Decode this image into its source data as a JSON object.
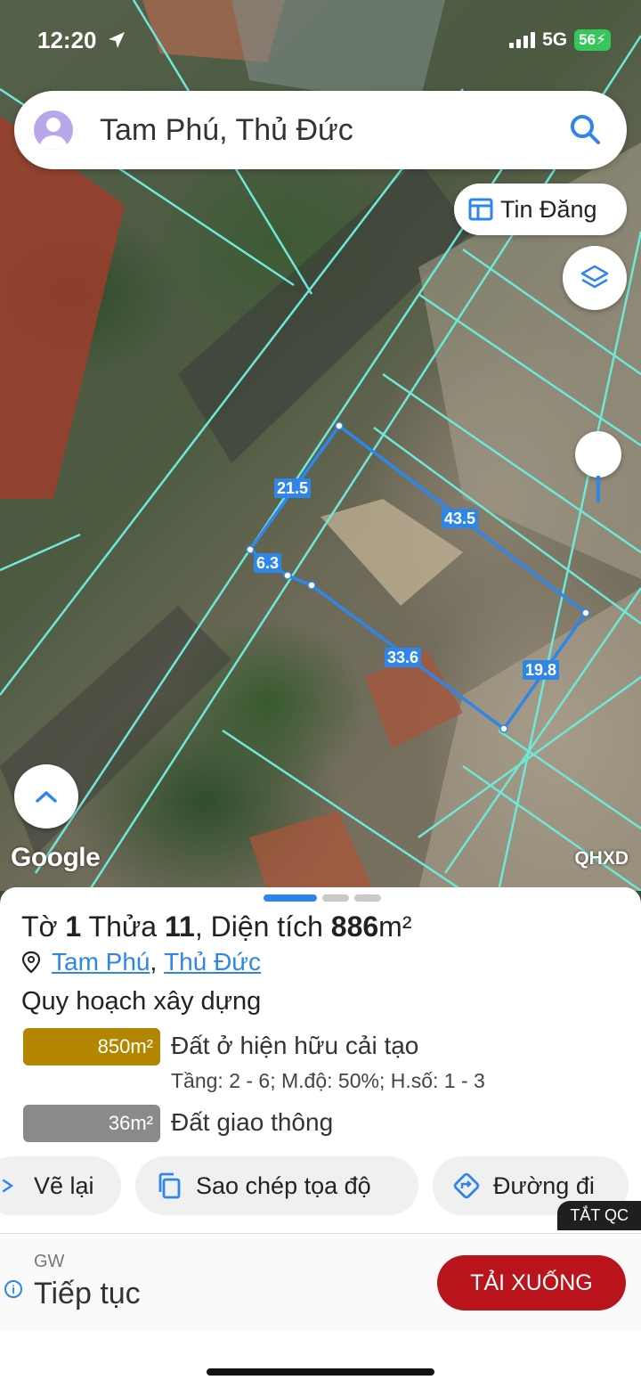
{
  "status_bar": {
    "time": "12:20",
    "network": "5G",
    "battery": "56"
  },
  "search": {
    "query": "Tam Phú, Thủ Đức"
  },
  "buttons": {
    "tin_dang": "Tin Đăng"
  },
  "map": {
    "dimensions": [
      "21.5",
      "43.5",
      "6.3",
      "33.6",
      "19.8"
    ],
    "google_logo": "Google",
    "overlay_logo": "QHXD",
    "parcel_color": "#2f86ea",
    "boundary_color": "#6ee8d8"
  },
  "parcel": {
    "to_label": "Tờ",
    "to_value": "1",
    "thua_label": "Thửa",
    "thua_value": "11",
    "area_label": ", Diện tích",
    "area_value": "886",
    "area_unit": "m²",
    "ward": "Tam Phú",
    "separator": ",",
    "district": "Thủ Đức"
  },
  "planning": {
    "section_title": "Quy hoạch xây dựng",
    "zones": [
      {
        "area": "850m²",
        "name": "Đất ở hiện hữu cải tạo",
        "detail": "Tầng: 2 - 6; M.độ: 50%; H.số: 1 - 3",
        "color": "#b38600"
      },
      {
        "area": "36m²",
        "name": "Đất giao thông",
        "detail": "",
        "color": "#8a8a8a"
      }
    ]
  },
  "actions": {
    "redraw": "Vẽ lại",
    "copy_coords": "Sao chép tọa độ",
    "directions": "Đường đi"
  },
  "ad": {
    "close_label": "TẮT QC",
    "brand": "GW",
    "title": "Tiếp tục",
    "cta": "TẢI XUỐNG",
    "cta_color": "#b9141c"
  }
}
